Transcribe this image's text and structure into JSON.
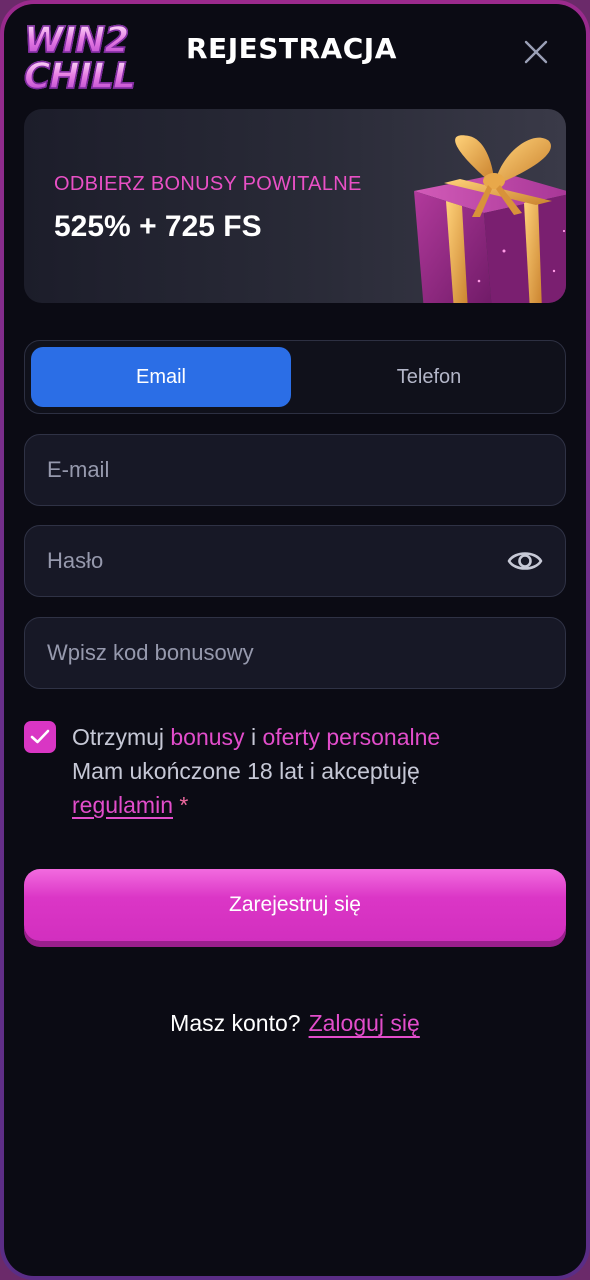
{
  "header": {
    "logo_line1": "WIN2",
    "logo_line2": "CHILL",
    "title": "REJESTRACJA",
    "close_icon": "close-icon"
  },
  "bonus": {
    "subtitle": "ODBIERZ BONUSY POWITALNE",
    "amount": "525% + 725 FS",
    "image_icon": "gift-box-icon"
  },
  "tabs": [
    {
      "label": "Email",
      "active": true
    },
    {
      "label": "Telefon",
      "active": false
    }
  ],
  "form": {
    "email_placeholder": "E-mail",
    "email_value": "",
    "password_placeholder": "Hasło",
    "password_value": "",
    "password_icon": "eye-icon",
    "bonus_code_placeholder": "Wpisz kod bonusowy",
    "bonus_code_value": ""
  },
  "consent": {
    "checked": true,
    "text_before": "Otrzymuj ",
    "bonus_link": "bonusy",
    "and": " i ",
    "offers_link": "oferty personalne",
    "age_text": "Mam ukończone 18 lat i akceptuję",
    "terms_link": "regulamin",
    "required_mark": "*"
  },
  "register_button": "Zarejestruj się",
  "login": {
    "prompt": "Masz konto?",
    "link": "Zaloguj się"
  },
  "colors": {
    "accent_pink": "#e24dcb",
    "tab_active_blue": "#2b6ee6",
    "background": "#0b0b14"
  }
}
